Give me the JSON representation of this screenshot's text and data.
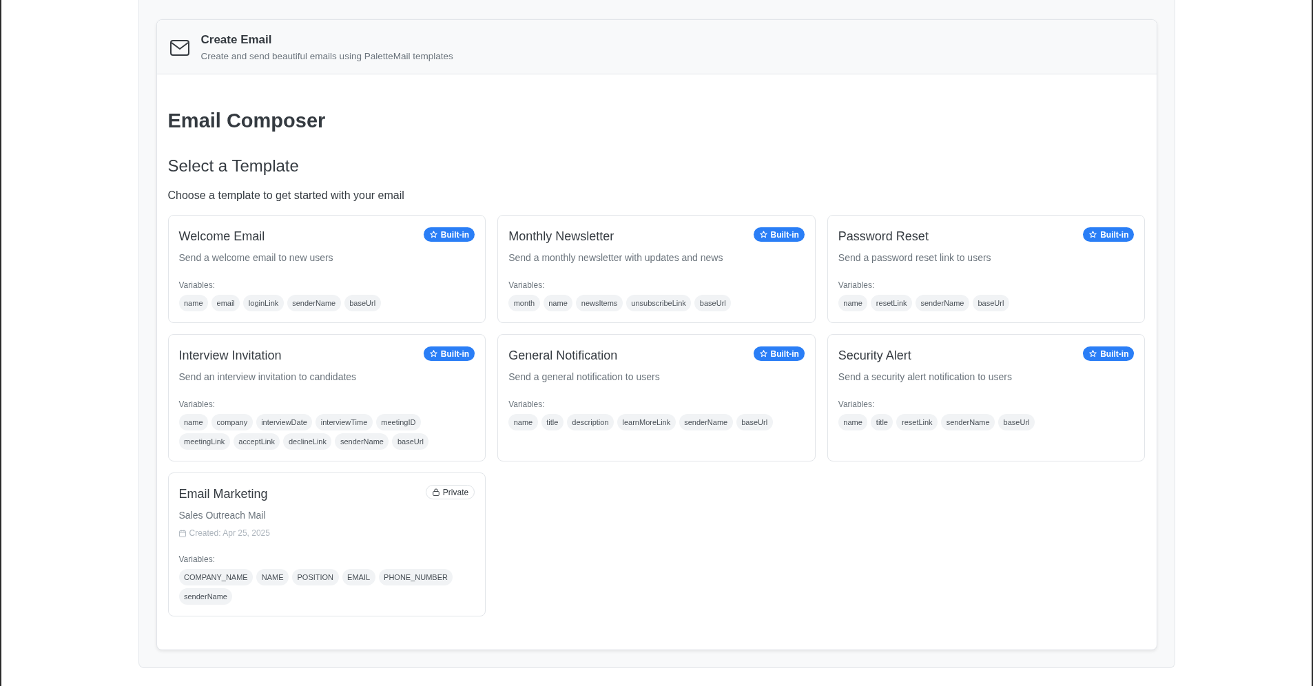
{
  "header": {
    "title": "Create Email",
    "subtitle": "Create and send beautiful emails using PaletteMail templates"
  },
  "page_title": "Email Composer",
  "section": {
    "title": "Select a Template",
    "subtitle": "Choose a template to get started with your email"
  },
  "templates": [
    {
      "name": "Welcome Email",
      "kind": "builtin",
      "badge": "Built-in",
      "description": "Send a welcome email to new users",
      "variables_label": "Variables:",
      "variables": [
        "name",
        "email",
        "loginLink",
        "senderName",
        "baseUrl"
      ]
    },
    {
      "name": "Monthly Newsletter",
      "kind": "builtin",
      "badge": "Built-in",
      "description": "Send a monthly newsletter with updates and news",
      "variables_label": "Variables:",
      "variables": [
        "month",
        "name",
        "newsItems",
        "unsubscribeLink",
        "baseUrl"
      ]
    },
    {
      "name": "Password Reset",
      "kind": "builtin",
      "badge": "Built-in",
      "description": "Send a password reset link to users",
      "variables_label": "Variables:",
      "variables": [
        "name",
        "resetLink",
        "senderName",
        "baseUrl"
      ]
    },
    {
      "name": "Interview Invitation",
      "kind": "builtin",
      "badge": "Built-in",
      "description": "Send an interview invitation to candidates",
      "variables_label": "Variables:",
      "variables": [
        "name",
        "company",
        "interviewDate",
        "interviewTime",
        "meetingID",
        "meetingLink",
        "acceptLink",
        "declineLink",
        "senderName",
        "baseUrl"
      ]
    },
    {
      "name": "General Notification",
      "kind": "builtin",
      "badge": "Built-in",
      "description": "Send a general notification to users",
      "variables_label": "Variables:",
      "variables": [
        "name",
        "title",
        "description",
        "learnMoreLink",
        "senderName",
        "baseUrl"
      ]
    },
    {
      "name": "Security Alert",
      "kind": "builtin",
      "badge": "Built-in",
      "description": "Send a security alert notification to users",
      "variables_label": "Variables:",
      "variables": [
        "name",
        "title",
        "resetLink",
        "senderName",
        "baseUrl"
      ]
    },
    {
      "name": "Email Marketing",
      "kind": "private",
      "badge": "Private",
      "description": "Sales Outreach Mail",
      "created": "Created: Apr 25, 2025",
      "variables_label": "Variables:",
      "variables": [
        "COMPANY_NAME",
        "NAME",
        "POSITION",
        "EMAIL",
        "PHONE_NUMBER",
        "senderName"
      ]
    }
  ]
}
